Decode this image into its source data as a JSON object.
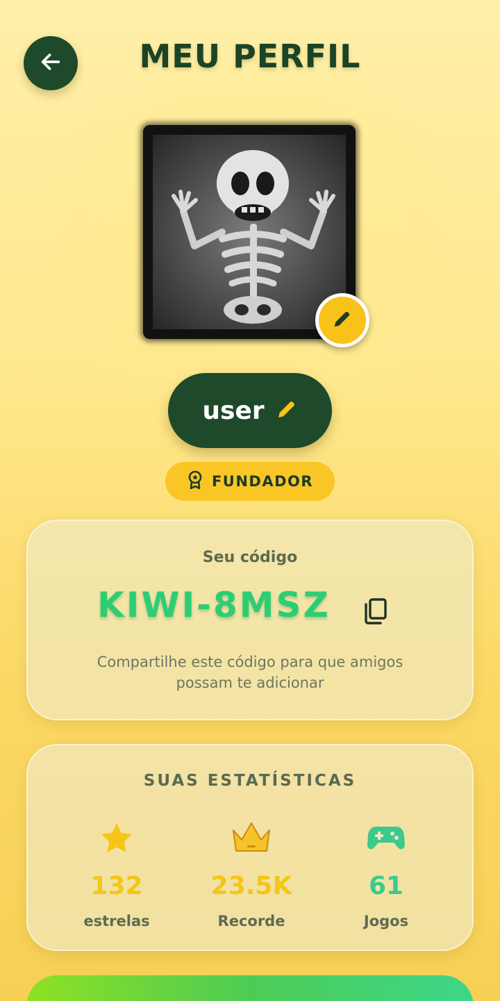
{
  "header": {
    "title": "MEU PERFIL"
  },
  "profile": {
    "username": "user",
    "badge": "FUNDADOR"
  },
  "code_card": {
    "label": "Seu código",
    "code": "KIWI-8MSZ",
    "help": "Compartilhe este código para que amigos possam te adicionar"
  },
  "stats": {
    "title": "SUAS ESTATÍSTICAS",
    "items": [
      {
        "icon": "star-icon",
        "value": "132",
        "label": "estrelas",
        "color": "#f5c518"
      },
      {
        "icon": "crown-icon",
        "value": "23.5K",
        "label": "Recorde",
        "color": "#f5c518"
      },
      {
        "icon": "gamepad-icon",
        "value": "61",
        "label": "Jogos",
        "color": "#3cc98e"
      }
    ]
  },
  "colors": {
    "dark_green": "#1e4a2b",
    "code_green": "#2dce73",
    "gold": "#f9c626"
  }
}
